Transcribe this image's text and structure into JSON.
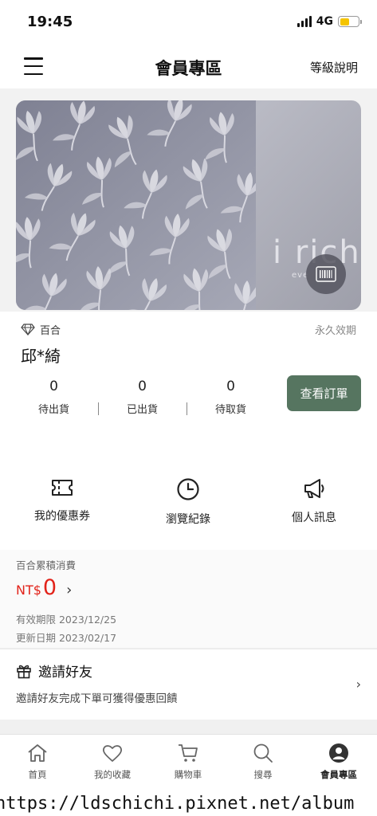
{
  "status_bar": {
    "time": "19:45",
    "network": "4G"
  },
  "nav": {
    "title": "會員專區",
    "level_link": "等級說明"
  },
  "card": {
    "brand": "i rich",
    "sub": "eve"
  },
  "member": {
    "tier": "百合",
    "validity": "永久效期",
    "name": "邱*綺",
    "stats": [
      {
        "value": "0",
        "label": "待出貨"
      },
      {
        "value": "0",
        "label": "已出貨"
      },
      {
        "value": "0",
        "label": "待取貨"
      }
    ],
    "view_orders": "查看訂單"
  },
  "shortcuts": [
    {
      "label": "我的優惠券",
      "icon": "coupon-icon"
    },
    {
      "label": "瀏覽紀錄",
      "icon": "clock-icon"
    },
    {
      "label": "個人訊息",
      "icon": "megaphone-icon"
    }
  ],
  "spending": {
    "title": "百合累積消費",
    "currency": "NT$",
    "amount": "0",
    "expiry": "有效期限 2023/12/25",
    "updated": "更新日期 2023/02/17"
  },
  "invite": {
    "title": "邀請好友",
    "description": "邀請好友完成下單可獲得優惠回饋"
  },
  "tabs": [
    {
      "label": "首頁",
      "icon": "home-icon"
    },
    {
      "label": "我的收藏",
      "icon": "heart-icon"
    },
    {
      "label": "購物車",
      "icon": "cart-icon"
    },
    {
      "label": "搜尋",
      "icon": "search-icon"
    },
    {
      "label": "會員專區",
      "icon": "user-icon"
    }
  ],
  "watermark": "https://ldschichi.pixnet.net/album"
}
